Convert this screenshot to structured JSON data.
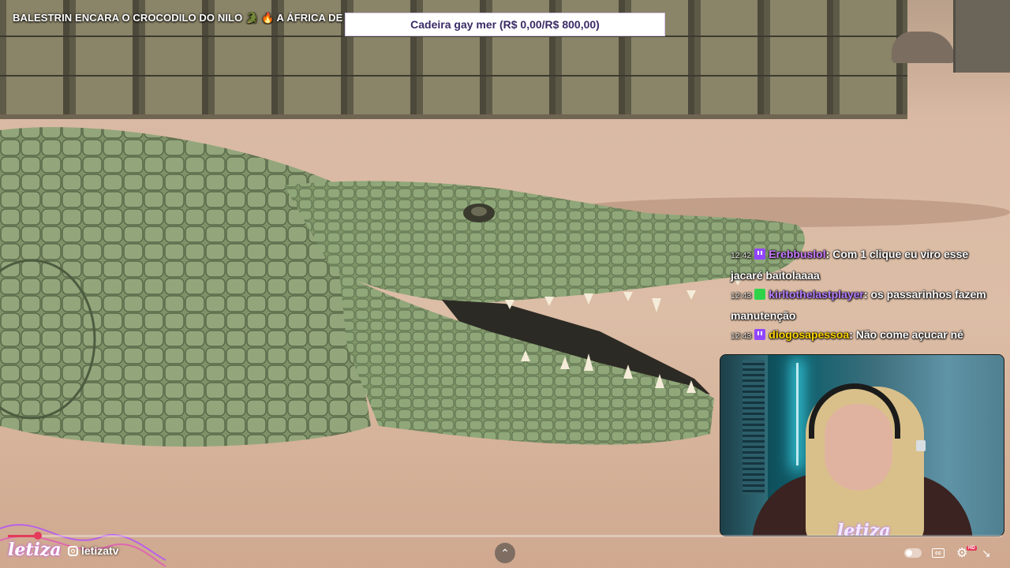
{
  "stream": {
    "title": "BALESTRIN ENCARA O CROCODILO DO NILO 🐊 🔥 A ÁFRICA DE VERDADE",
    "goal_text": "Cadeira gay mer (R$ 0,00/R$ 800,00)"
  },
  "chat": [
    {
      "time": "12:42",
      "badge": "twitch",
      "user": "Erebbuslol",
      "user_color": "#c879ff",
      "text": "Com 1 clique eu viro esse jacaré baitolaaaa"
    },
    {
      "time": "12:43",
      "badge": "green",
      "user": "kirltothelastplayer",
      "user_color": "#b47cff",
      "text": "os passarinhos fazem manutenção"
    },
    {
      "time": "12:43",
      "badge": "twitch",
      "user": "diogosapessoa",
      "user_color": "#ffd400",
      "text": "Não come açucar né"
    }
  ],
  "webcam": {
    "overlay_logo": "letiza"
  },
  "branding": {
    "logo": "letiza",
    "social_icon": "instagram-icon",
    "social_handle": "letizatv"
  },
  "player": {
    "progress": 0.03,
    "expand_icon": "chevron-up-icon",
    "controls": [
      "autoplay-toggle",
      "captions-icon",
      "settings-gear-icon",
      "collapse-icon"
    ],
    "quality_badge": "HD",
    "accent_color": "#e43b5a"
  }
}
